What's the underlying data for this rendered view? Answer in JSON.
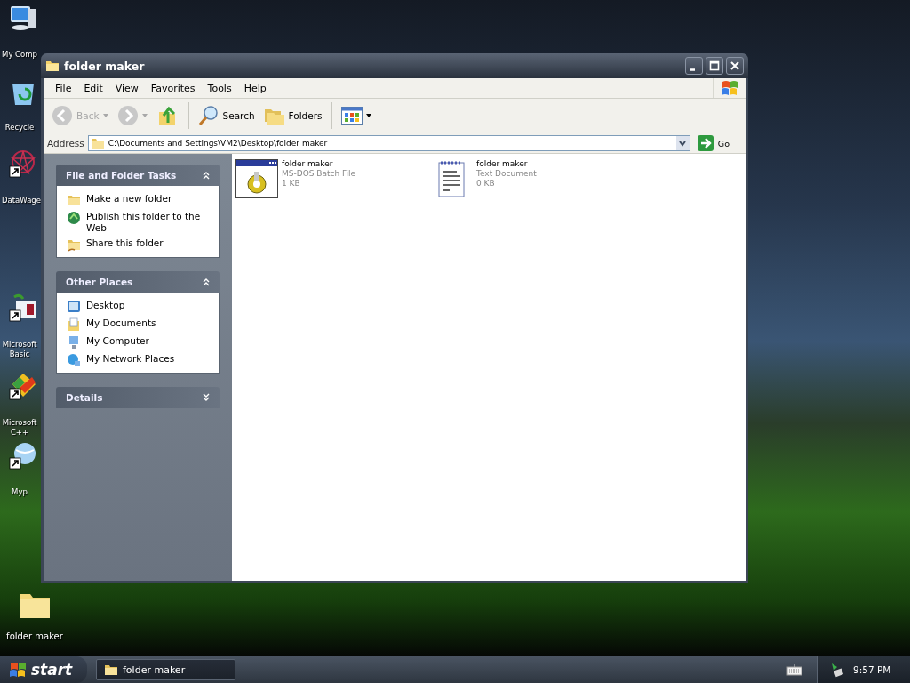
{
  "desktop_icons": [
    {
      "kind": "computer",
      "shortcut": false,
      "lines": [
        "My Comp"
      ]
    },
    {
      "kind": "recycle",
      "shortcut": false,
      "lines": [
        "Recycle"
      ]
    },
    {
      "kind": "star",
      "shortcut": true,
      "lines": [
        "DataWage"
      ]
    },
    {
      "kind": "basic",
      "shortcut": true,
      "lines": [
        "Microsoft",
        "Basic"
      ]
    },
    {
      "kind": "cpp",
      "shortcut": true,
      "lines": [
        "Microsoft",
        "C++"
      ]
    },
    {
      "kind": "globe",
      "shortcut": true,
      "lines": [
        "Myp"
      ]
    }
  ],
  "desktop_folder": {
    "label": "folder maker"
  },
  "window": {
    "title": "folder maker",
    "menu": [
      "File",
      "Edit",
      "View",
      "Favorites",
      "Tools",
      "Help"
    ],
    "toolbar": {
      "back": {
        "label": "Back",
        "disabled": true
      },
      "forward": {
        "disabled": true
      },
      "search": "Search",
      "folders": "Folders"
    },
    "address": {
      "label": "Address",
      "value": "C:\\Documents and Settings\\VM2\\Desktop\\folder maker",
      "go": "Go"
    },
    "panels": [
      {
        "title": "File and Folder Tasks",
        "expanded": true,
        "items": [
          {
            "kind": "new-folder",
            "label": "Make a new folder"
          },
          {
            "kind": "globe",
            "label": "Publish this folder to the Web"
          },
          {
            "kind": "share",
            "label": "Share this folder"
          }
        ]
      },
      {
        "title": "Other Places",
        "expanded": true,
        "items": [
          {
            "kind": "desktop",
            "label": "Desktop"
          },
          {
            "kind": "documents",
            "label": "My Documents"
          },
          {
            "kind": "computer",
            "label": "My Computer"
          },
          {
            "kind": "network",
            "label": "My Network Places"
          }
        ]
      },
      {
        "title": "Details",
        "expanded": false
      }
    ],
    "files": [
      {
        "kind": "batch",
        "name": "folder maker",
        "type": "MS-DOS Batch File",
        "size": "1 KB"
      },
      {
        "kind": "text",
        "name": "folder maker",
        "type": "Text Document",
        "size": "0 KB"
      }
    ]
  },
  "taskbar": {
    "start": "start",
    "tasks": [
      {
        "label": "folder maker"
      }
    ],
    "clock": "9:57 PM"
  }
}
